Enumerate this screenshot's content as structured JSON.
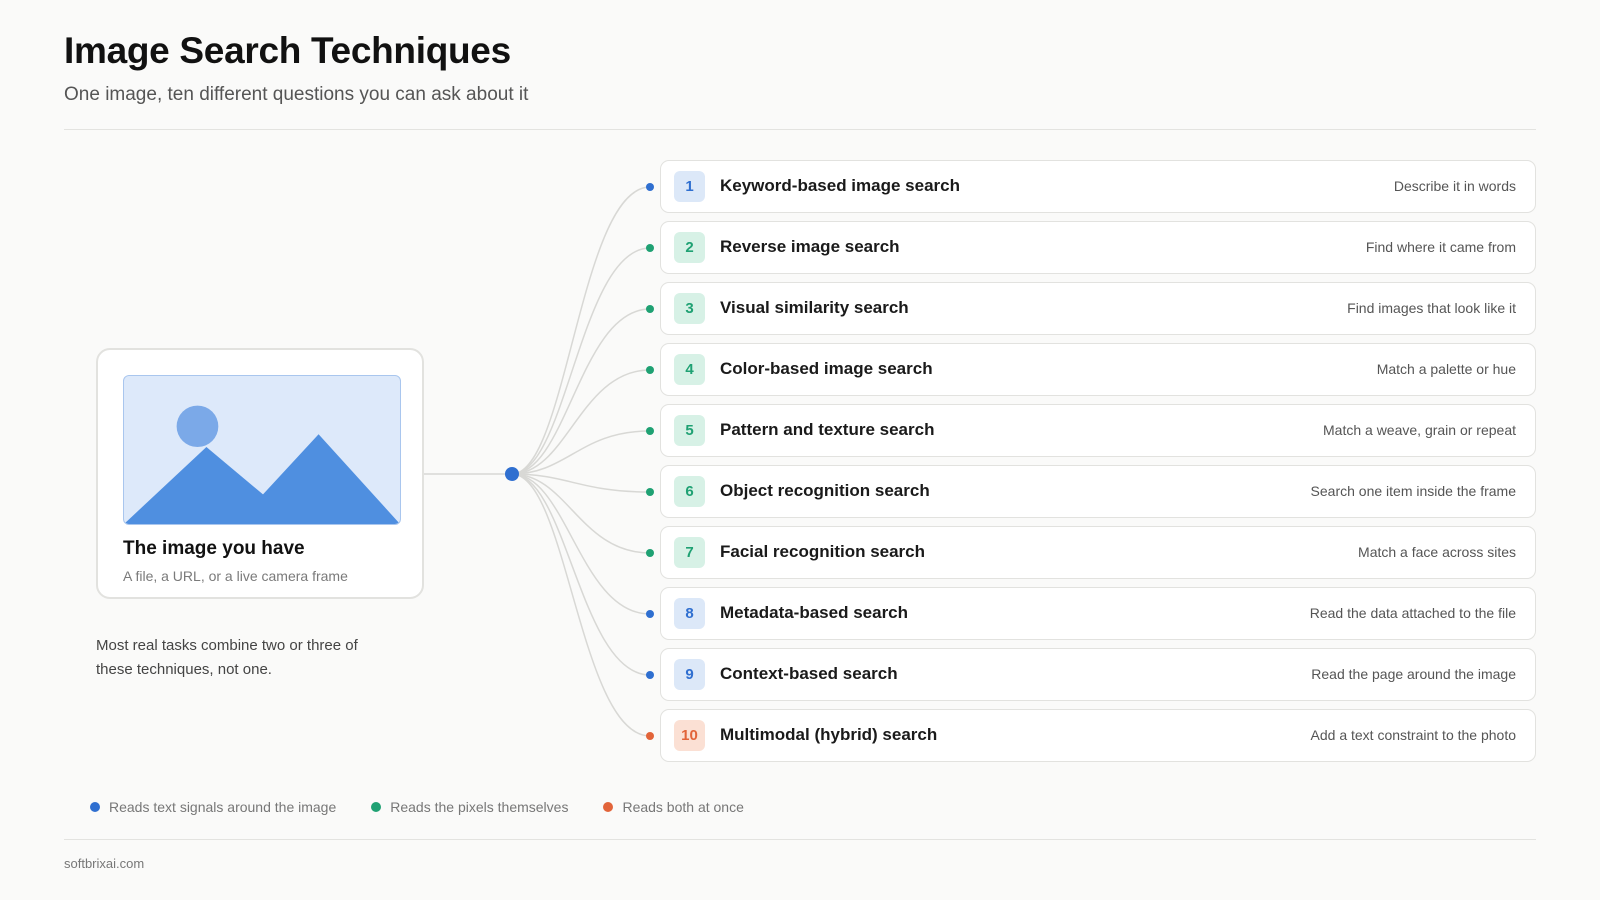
{
  "header": {
    "title": "Image Search Techniques",
    "subtitle": "One image, ten different questions you can ask about it"
  },
  "source": {
    "title": "The image you have",
    "subtitle": "A file, a URL, or a live camera frame",
    "illustration_icon": "image-placeholder-icon"
  },
  "note": "Most real tasks combine two or three of these techniques, not one.",
  "colors": {
    "text": "#2f6fd0",
    "pixel": "#1fa173",
    "both": "#e2643a",
    "hub": "#2f6fd0",
    "connector": "#d8d8d5"
  },
  "techniques": [
    {
      "number": "1",
      "name": "Keyword-based image search",
      "description": "Describe it in words",
      "category": "text"
    },
    {
      "number": "2",
      "name": "Reverse image search",
      "description": "Find where it came from",
      "category": "pixel"
    },
    {
      "number": "3",
      "name": "Visual similarity search",
      "description": "Find images that look like it",
      "category": "pixel"
    },
    {
      "number": "4",
      "name": "Color-based image search",
      "description": "Match a palette or hue",
      "category": "pixel"
    },
    {
      "number": "5",
      "name": "Pattern and texture search",
      "description": "Match a weave, grain or repeat",
      "category": "pixel"
    },
    {
      "number": "6",
      "name": "Object recognition search",
      "description": "Search one item inside the frame",
      "category": "pixel"
    },
    {
      "number": "7",
      "name": "Facial recognition search",
      "description": "Match a face across sites",
      "category": "pixel"
    },
    {
      "number": "8",
      "name": "Metadata-based search",
      "description": "Read the data attached to the file",
      "category": "text"
    },
    {
      "number": "9",
      "name": "Context-based search",
      "description": "Read the page around the image",
      "category": "text"
    },
    {
      "number": "10",
      "name": "Multimodal (hybrid) search",
      "description": "Add a text constraint to the photo",
      "category": "both"
    }
  ],
  "legend": [
    {
      "label": "Reads text signals around the image",
      "category": "text"
    },
    {
      "label": "Reads the pixels themselves",
      "category": "pixel"
    },
    {
      "label": "Reads both at once",
      "category": "both"
    }
  ],
  "footer": "softbrixai.com"
}
